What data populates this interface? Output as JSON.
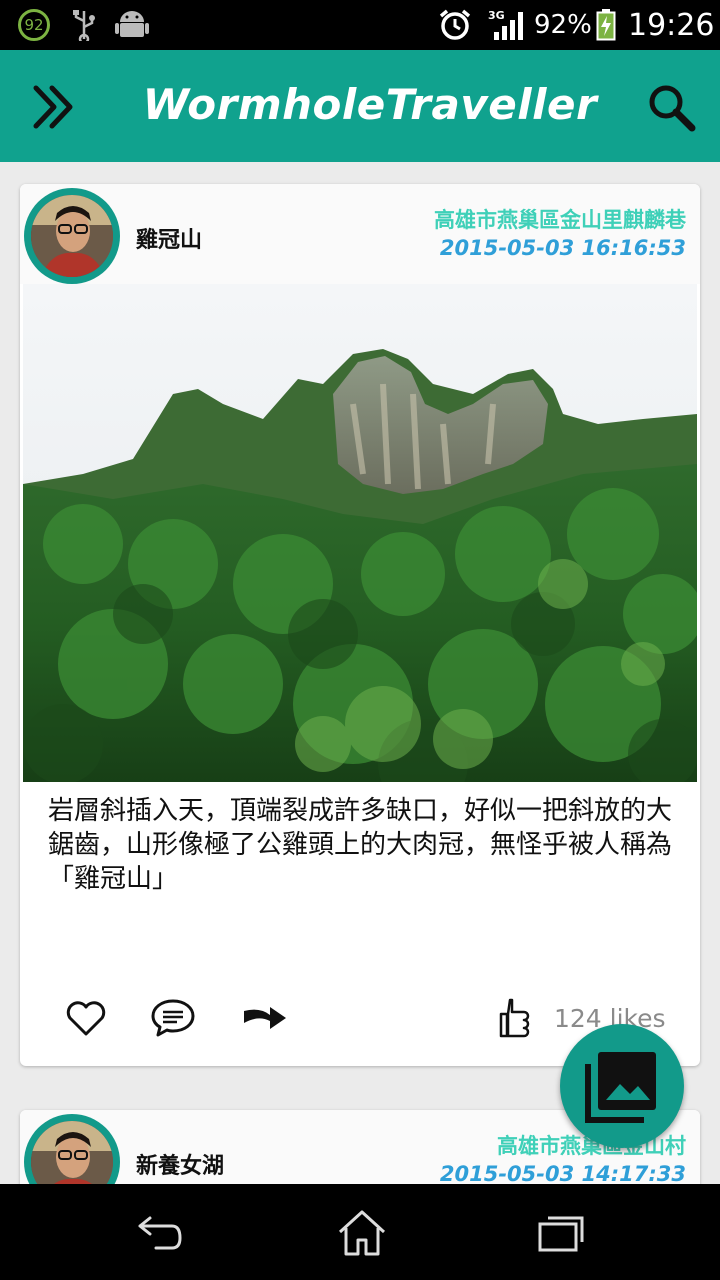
{
  "status_bar": {
    "badge": "92",
    "signal_type": "3G",
    "battery_percent": "92%",
    "time": "19:26",
    "icons": [
      "notification-badge-icon",
      "usb-icon",
      "android-icon",
      "alarm-icon",
      "signal-icon",
      "battery-charging-icon"
    ]
  },
  "app_bar": {
    "title": "WormholeTraveller",
    "menu_icon": "double-chevron-right-icon",
    "search_icon": "search-icon"
  },
  "colors": {
    "primary": "#10a28e",
    "location_text": "#3fd0b8",
    "timestamp_text": "#2f9fd8"
  },
  "posts": [
    {
      "name": "雞冠山",
      "location": "高雄市燕巢區金山里麒麟巷",
      "timestamp": "2015-05-03 16:16:53",
      "text": "岩層斜插入天，頂端裂成許多缺口，好似一把斜放的大鋸齒，山形像極了公雞頭上的大肉冠，無怪乎被人稱為「雞冠山」",
      "likes": "124 likes",
      "actions": [
        "heart-icon",
        "comment-icon",
        "share-icon",
        "thumbs-up-icon"
      ]
    },
    {
      "name": "新養女湖",
      "location": "高雄市燕巢區金山村",
      "timestamp": "2015-05-03 14:17:33"
    }
  ],
  "fab": {
    "icon": "photo-library-icon"
  },
  "nav_bar": {
    "icons": [
      "back-icon",
      "home-icon",
      "recent-apps-icon"
    ]
  }
}
